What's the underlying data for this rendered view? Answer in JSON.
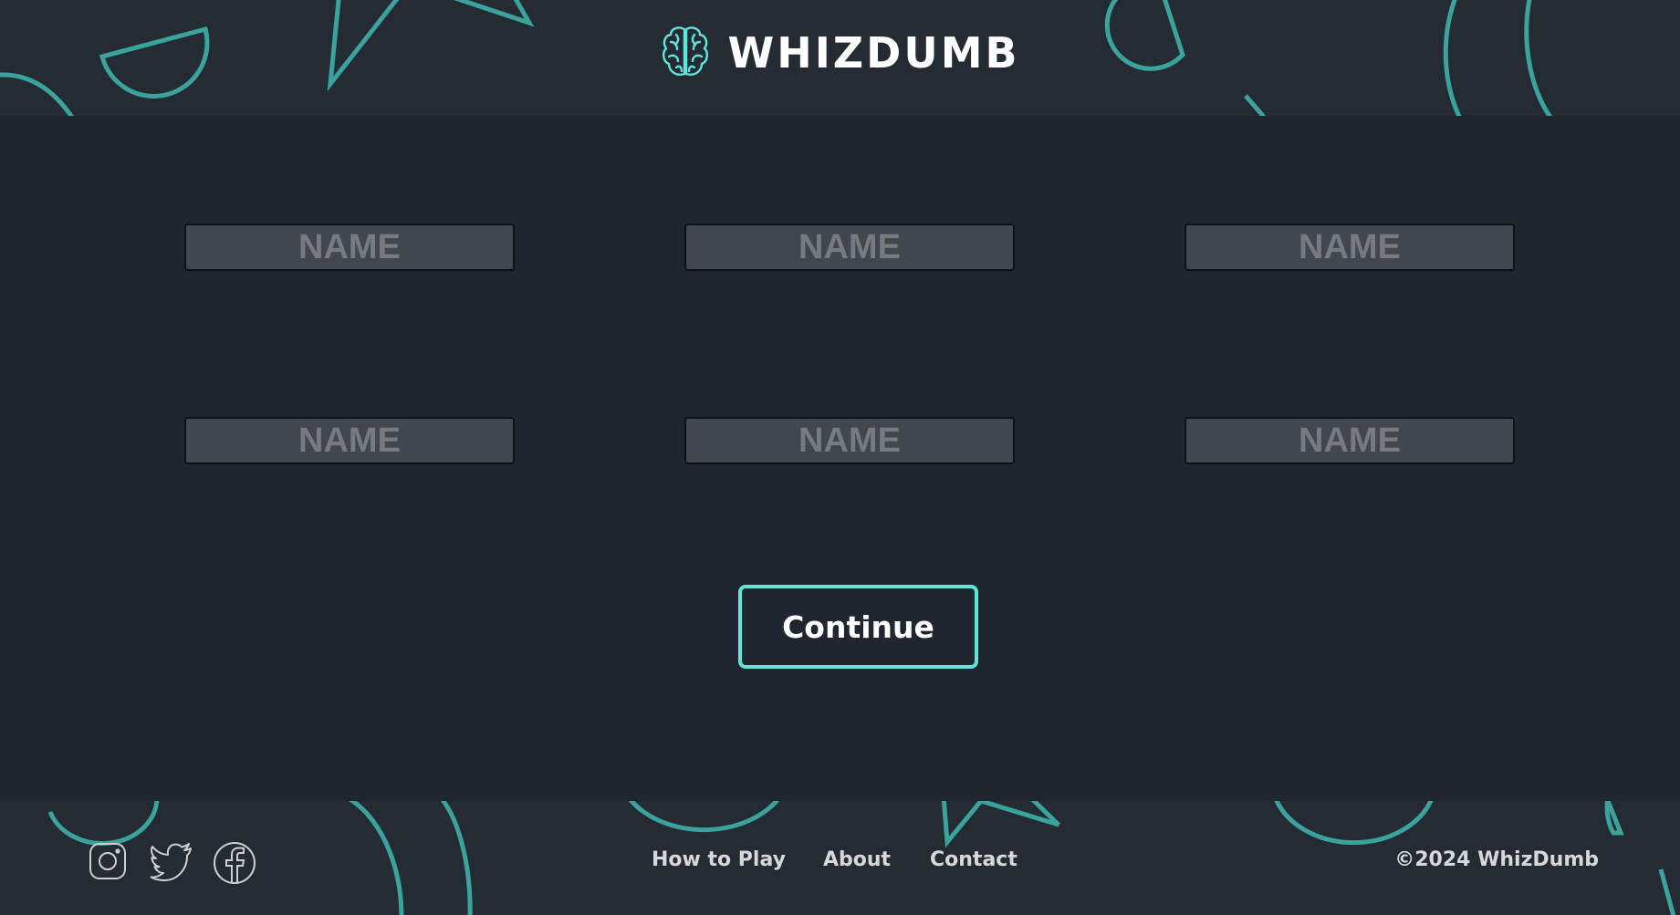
{
  "brand": {
    "name": "WHIZDUMB",
    "icon": "brain-icon"
  },
  "players": {
    "placeholder": "NAME",
    "inputs": [
      {
        "value": ""
      },
      {
        "value": ""
      },
      {
        "value": ""
      },
      {
        "value": ""
      },
      {
        "value": ""
      },
      {
        "value": ""
      }
    ]
  },
  "continue_label": "Continue",
  "footer": {
    "social": [
      "instagram-icon",
      "twitter-icon",
      "facebook-icon"
    ],
    "links": [
      "How to Play",
      "About",
      "Contact"
    ],
    "copyright": "©2024 WhizDumb"
  },
  "colors": {
    "accent": "#5fe6dc",
    "shape_stroke": "#3aa39d",
    "background": "#1f262f",
    "band": "#252b33",
    "input_bg": "#41464f"
  }
}
